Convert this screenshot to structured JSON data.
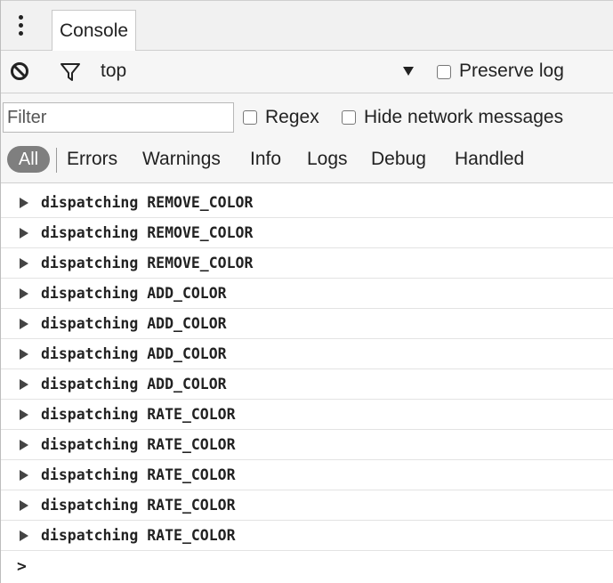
{
  "tabs": {
    "menu_icon": "kebab-menu-icon",
    "active_tab": "Console"
  },
  "toolbar": {
    "clear_icon": "clear-console-icon",
    "filter_icon": "filter-icon",
    "context": "top",
    "preserve_log_label": "Preserve log"
  },
  "filter": {
    "placeholder": "Filter",
    "regex_label": "Regex",
    "hide_network_label": "Hide network messages"
  },
  "levels": {
    "all": "All",
    "items": [
      "Errors",
      "Warnings",
      "Info",
      "Logs",
      "Debug",
      "Handled"
    ]
  },
  "log": {
    "messages": [
      "dispatching REMOVE_COLOR",
      "dispatching REMOVE_COLOR",
      "dispatching REMOVE_COLOR",
      "dispatching ADD_COLOR",
      "dispatching ADD_COLOR",
      "dispatching ADD_COLOR",
      "dispatching ADD_COLOR",
      "dispatching RATE_COLOR",
      "dispatching RATE_COLOR",
      "dispatching RATE_COLOR",
      "dispatching RATE_COLOR",
      "dispatching RATE_COLOR"
    ],
    "prompt": ">"
  }
}
